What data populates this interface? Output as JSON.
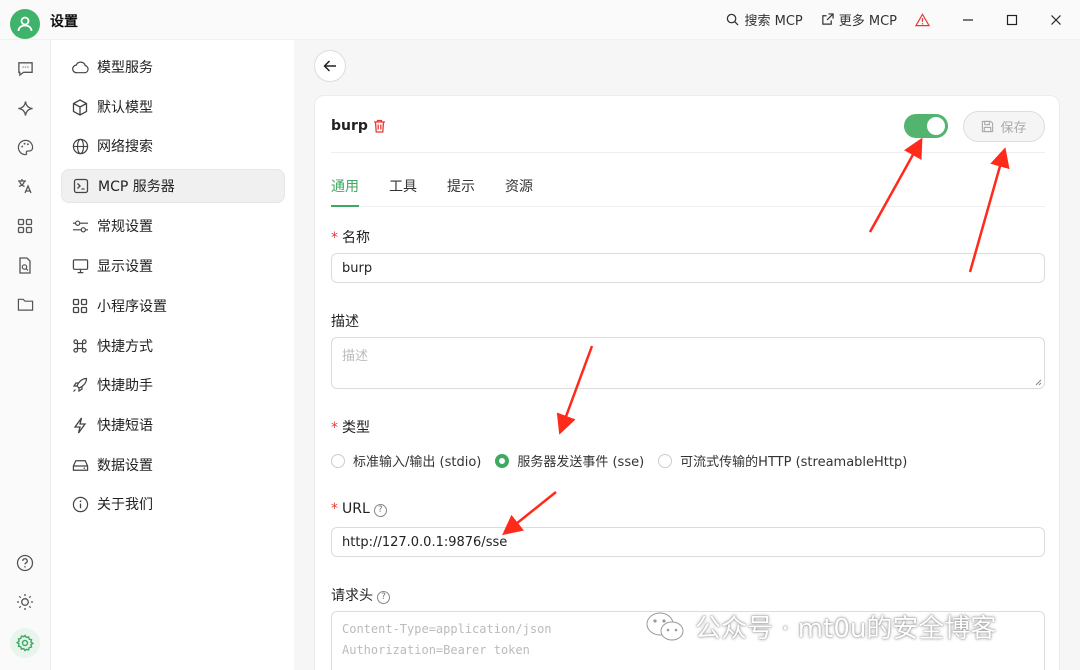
{
  "window": {
    "title": "设置",
    "actions": [
      {
        "label": "搜索 MCP"
      },
      {
        "label": "更多 MCP"
      }
    ]
  },
  "nav": {
    "items": [
      {
        "label": "模型服务",
        "icon": "cloud-icon"
      },
      {
        "label": "默认模型",
        "icon": "cube-icon"
      },
      {
        "label": "网络搜索",
        "icon": "globe-icon"
      },
      {
        "label": "MCP 服务器",
        "icon": "terminal-icon",
        "active": true
      },
      {
        "label": "常规设置",
        "icon": "sliders-icon"
      },
      {
        "label": "显示设置",
        "icon": "monitor-icon"
      },
      {
        "label": "小程序设置",
        "icon": "grid-icon"
      },
      {
        "label": "快捷方式",
        "icon": "command-icon"
      },
      {
        "label": "快捷助手",
        "icon": "rocket-icon"
      },
      {
        "label": "快捷短语",
        "icon": "bolt-icon"
      },
      {
        "label": "数据设置",
        "icon": "drive-icon"
      },
      {
        "label": "关于我们",
        "icon": "info-icon"
      }
    ]
  },
  "server": {
    "name": "burp",
    "enabled": true,
    "save_label": "保存",
    "tabs": [
      "通用",
      "工具",
      "提示",
      "资源"
    ],
    "active_tab": 0,
    "fields": {
      "name_label": "名称",
      "name_value": "burp",
      "desc_label": "描述",
      "desc_placeholder": "描述",
      "type_label": "类型",
      "type_options": [
        {
          "label": "标准输入/输出 (stdio)",
          "selected": false
        },
        {
          "label": "服务器发送事件 (sse)",
          "selected": true
        },
        {
          "label": "可流式传输的HTTP (streamableHttp)",
          "selected": false
        }
      ],
      "url_label": "URL",
      "url_value": "http://127.0.0.1:9876/sse",
      "headers_label": "请求头",
      "headers_placeholder_1": "Content-Type=application/json",
      "headers_placeholder_2": "Authorization=Bearer token"
    }
  },
  "watermark": "公众号 · mt0u的安全博客",
  "colors": {
    "accent": "#3fa862",
    "toggle_on": "#52b46e",
    "required": "#e53935",
    "annotation_arrow": "#ff2a1a",
    "warning": "#e53935"
  }
}
